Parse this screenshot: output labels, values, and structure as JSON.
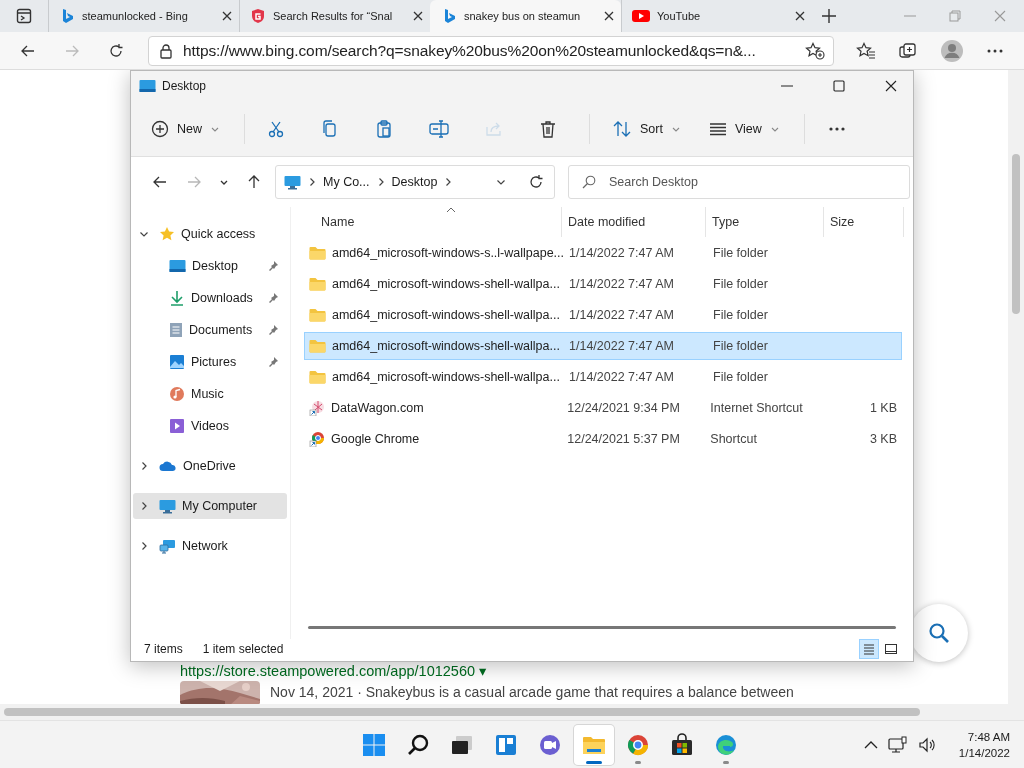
{
  "browser": {
    "tabs": [
      {
        "kind": "bing",
        "title": "steamunlocked - Bing",
        "selected": false
      },
      {
        "kind": "shield",
        "title": "Search Results for “Snal",
        "selected": false
      },
      {
        "kind": "bing",
        "title": "snakey bus on steamun",
        "selected": true
      },
      {
        "kind": "youtube",
        "title": "YouTube",
        "selected": false
      }
    ],
    "nav": [
      {
        "kind": "back",
        "disabled": false
      },
      {
        "kind": "forward",
        "disabled": true
      },
      {
        "kind": "refresh",
        "disabled": false
      }
    ],
    "address": "https://www.bing.com/search?q=snakey%20bus%20on%20steamunlocked&qs=n&..."
  },
  "page": {
    "result_url": "https://store.steampowered.com/app/1012560 ▾",
    "snippet": "Nov 14, 2021 · Snakeybus is a casual arcade game that requires a balance between"
  },
  "explorer": {
    "title": "Desktop",
    "toolbar": [
      {
        "kind": "new",
        "label": "New",
        "disabled": false
      },
      {
        "kind": "cut",
        "disabled": false
      },
      {
        "kind": "copy",
        "disabled": false
      },
      {
        "kind": "paste",
        "disabled": false
      },
      {
        "kind": "rename",
        "disabled": false
      },
      {
        "kind": "share",
        "disabled": true
      },
      {
        "kind": "delete",
        "disabled": false
      },
      {
        "kind": "sort",
        "label": "Sort",
        "disabled": false
      },
      {
        "kind": "view",
        "label": "View",
        "disabled": false
      },
      {
        "kind": "more",
        "disabled": false
      }
    ],
    "nav": [
      {
        "kind": "back",
        "disabled": false
      },
      {
        "kind": "forward",
        "disabled": true
      },
      {
        "kind": "recent",
        "disabled": false
      },
      {
        "kind": "up",
        "disabled": false
      }
    ],
    "breadcrumb": [
      "My Co...",
      "Desktop"
    ],
    "search_placeholder": "Search Desktop",
    "sidebar": [
      {
        "kind": "star",
        "label": "Quick access",
        "expanded": true,
        "selected": false,
        "children": [
          {
            "kind": "desktop",
            "label": "Desktop",
            "pinned": true,
            "selected": false
          },
          {
            "kind": "downloads",
            "label": "Downloads",
            "pinned": true,
            "selected": false
          },
          {
            "kind": "documents",
            "label": "Documents",
            "pinned": true,
            "selected": false
          },
          {
            "kind": "pictures",
            "label": "Pictures",
            "pinned": true,
            "selected": false
          },
          {
            "kind": "music",
            "label": "Music",
            "pinned": false,
            "selected": false
          },
          {
            "kind": "videos",
            "label": "Videos",
            "pinned": false,
            "selected": false
          }
        ]
      },
      {
        "kind": "cloud",
        "label": "OneDrive",
        "expanded": false,
        "selected": false
      },
      {
        "kind": "computer",
        "label": "My Computer",
        "expanded": false,
        "selected": true
      },
      {
        "kind": "network",
        "label": "Network",
        "expanded": false,
        "selected": false
      }
    ],
    "columns": [
      "Name",
      "Date modified",
      "Type",
      "Size"
    ],
    "rows": [
      {
        "kind": "folder",
        "name": "amd64_microsoft-windows-s..l-wallpape...",
        "date": "1/14/2022 7:47 AM",
        "type": "File folder",
        "selected": false
      },
      {
        "kind": "folder",
        "name": "amd64_microsoft-windows-shell-wallpa...",
        "date": "1/14/2022 7:47 AM",
        "type": "File folder",
        "selected": false
      },
      {
        "kind": "folder",
        "name": "amd64_microsoft-windows-shell-wallpa...",
        "date": "1/14/2022 7:47 AM",
        "type": "File folder",
        "selected": false
      },
      {
        "kind": "folder",
        "name": "amd64_microsoft-windows-shell-wallpa...",
        "date": "1/14/2022 7:47 AM",
        "type": "File folder",
        "selected": true
      },
      {
        "kind": "folder",
        "name": "amd64_microsoft-windows-shell-wallpa...",
        "date": "1/14/2022 7:47 AM",
        "type": "File folder",
        "selected": false
      },
      {
        "kind": "web-shortcut",
        "name": "DataWagon.com",
        "date": "12/24/2021 9:34 PM",
        "type": "Internet Shortcut",
        "size": "1 KB",
        "selected": false
      },
      {
        "kind": "chrome-shortcut",
        "name": "Google Chrome",
        "date": "12/24/2021 5:37 PM",
        "type": "Shortcut",
        "size": "3 KB",
        "selected": false
      }
    ],
    "status": {
      "count": "7 items",
      "selection": "1 item selected"
    },
    "views": [
      {
        "kind": "details",
        "selected": true
      },
      {
        "kind": "tiles",
        "selected": false
      }
    ]
  },
  "taskbar": {
    "apps": [
      {
        "kind": "start",
        "active": false,
        "running": false
      },
      {
        "kind": "search",
        "active": false,
        "running": false
      },
      {
        "kind": "taskview",
        "active": false,
        "running": false
      },
      {
        "kind": "widgets",
        "active": false,
        "running": false
      },
      {
        "kind": "chat",
        "active": false,
        "running": false
      },
      {
        "kind": "explorer",
        "active": true,
        "running": true
      },
      {
        "kind": "chrome",
        "active": false,
        "running": true
      },
      {
        "kind": "store",
        "active": false,
        "running": false
      },
      {
        "kind": "edge",
        "active": false,
        "running": true
      }
    ],
    "time": "7:48 AM",
    "date": "1/14/2022"
  }
}
